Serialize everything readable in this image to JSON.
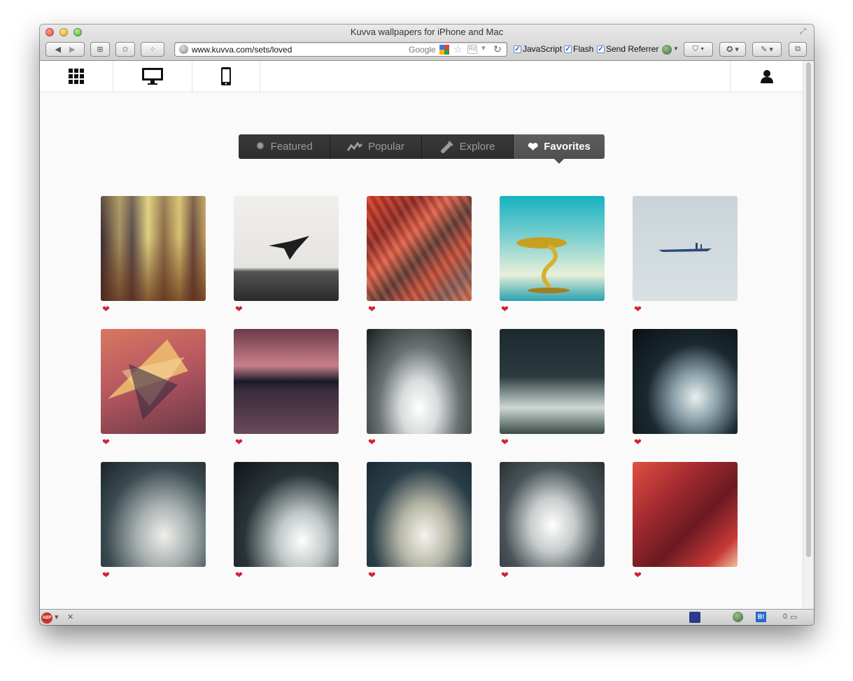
{
  "window": {
    "title": "Kuvva wallpapers for iPhone and Mac",
    "url": "www.kuvva.com/sets/loved",
    "search_engine": "Google",
    "checkboxes": [
      {
        "label": "JavaScript",
        "checked": true
      },
      {
        "label": "Flash",
        "checked": true
      },
      {
        "label": "Send Referrer",
        "checked": true
      }
    ],
    "status_count": "0"
  },
  "nav": {
    "icons": [
      "apps-grid-icon",
      "desktop-icon",
      "phone-icon",
      "user-icon"
    ]
  },
  "tabs": [
    {
      "label": "Featured",
      "icon": "badge-icon",
      "active": false
    },
    {
      "label": "Popular",
      "icon": "trend-icon",
      "active": false
    },
    {
      "label": "Explore",
      "icon": "flashlight-icon",
      "active": false
    },
    {
      "label": "Favorites",
      "icon": "heart-icon",
      "active": true
    }
  ],
  "gallery": {
    "heart_glyph": "❤",
    "heart_color": "#d0243b",
    "items": [
      {
        "name": "blurred-city-wallpaper"
      },
      {
        "name": "origami-bird-wallpaper"
      },
      {
        "name": "red-city-aerial-wallpaper"
      },
      {
        "name": "liquid-splash-wallpaper"
      },
      {
        "name": "misty-boat-wallpaper"
      },
      {
        "name": "geometric-triangles-wallpaper"
      },
      {
        "name": "pink-horizon-wallpaper"
      },
      {
        "name": "storm-wave-1-wallpaper"
      },
      {
        "name": "storm-wave-2-wallpaper"
      },
      {
        "name": "storm-wave-3-wallpaper"
      },
      {
        "name": "storm-wave-4-wallpaper"
      },
      {
        "name": "storm-wave-5-wallpaper"
      },
      {
        "name": "storm-wave-6-wallpaper"
      },
      {
        "name": "storm-wave-7-wallpaper"
      },
      {
        "name": "red-crystal-wallpaper"
      }
    ]
  }
}
